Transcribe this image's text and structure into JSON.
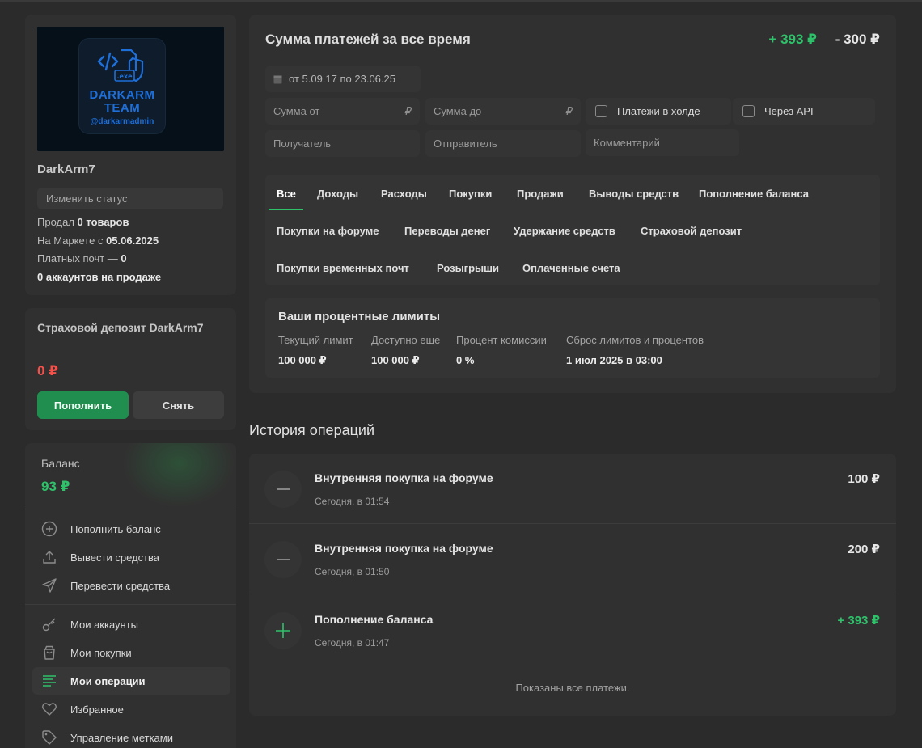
{
  "profile": {
    "logo_line1": "DARKARM",
    "logo_line2": "TEAM",
    "logo_handle": "@darkarmadmin",
    "logo_badge": ".exe",
    "username": "DarkArm7",
    "status_placeholder": "Изменить статус",
    "sold_prefix": "Продал ",
    "sold_count": "0 товаров",
    "market_prefix": "На Маркете с ",
    "market_since": "05.06.2025",
    "mail_prefix": "Платных почт — ",
    "mail_count": "0",
    "accounts_for_sale": "0 аккаунтов на продаже"
  },
  "deposit": {
    "title": "Страховой депозит DarkArm7",
    "amount": "0 ₽",
    "topup_label": "Пополнить",
    "withdraw_label": "Снять"
  },
  "balance": {
    "label": "Баланс",
    "value": "93 ₽",
    "menu": [
      {
        "label": "Пополнить баланс",
        "icon": "plus-circle-icon"
      },
      {
        "label": "Вывести средства",
        "icon": "upload-icon"
      },
      {
        "label": "Перевести средства",
        "icon": "send-icon"
      },
      {
        "label": "Мои аккаунты",
        "icon": "key-icon"
      },
      {
        "label": "Мои покупки",
        "icon": "bag-icon"
      },
      {
        "label": "Мои операции",
        "icon": "list-icon",
        "active": true
      },
      {
        "label": "Избранное",
        "icon": "heart-icon"
      },
      {
        "label": "Управление метками",
        "icon": "tag-icon"
      }
    ]
  },
  "summary": {
    "title": "Сумма платежей за все время",
    "plus": "+ 393 ₽",
    "minus": "- 300 ₽",
    "date_range": "от 5.09.17 по 23.06.25",
    "sum_from_placeholder": "Сумма от",
    "sum_to_placeholder": "Сумма до",
    "currency_symbol": "₽",
    "hold_label": "Платежи в холде",
    "api_label": "Через API",
    "recipient_placeholder": "Получатель",
    "sender_placeholder": "Отправитель",
    "comment_placeholder": "Комментарий",
    "tabs": [
      "Все",
      "Доходы",
      "Расходы",
      "Покупки",
      "Продажи",
      "Выводы средств",
      "Пополнение баланса",
      "Покупки на форуме",
      "Переводы денег",
      "Удержание средств",
      "Страховой депозит",
      "Покупки временных почт",
      "Розыгрыши",
      "Оплаченные счета"
    ]
  },
  "limits": {
    "title": "Ваши процентные лимиты",
    "columns": [
      {
        "head": "Текущий лимит",
        "value": "100 000 ₽"
      },
      {
        "head": "Доступно еще",
        "value": "100 000 ₽"
      },
      {
        "head": "Процент комиссии",
        "value": "0 %"
      },
      {
        "head": "Сброс лимитов и процентов",
        "value": "1 июл 2025 в 03:00"
      }
    ]
  },
  "history": {
    "title": "История операций",
    "operations": [
      {
        "name": "Внутренняя покупка на форуме",
        "time": "Сегодня, в 01:54",
        "amount": "100 ₽",
        "type": "minus"
      },
      {
        "name": "Внутренняя покупка на форуме",
        "time": "Сегодня, в 01:50",
        "amount": "200 ₽",
        "type": "minus"
      },
      {
        "name": "Пополнение баланса",
        "time": "Сегодня, в 01:47",
        "amount": "+ 393 ₽",
        "type": "plus"
      }
    ],
    "footer": "Показаны все платежи."
  },
  "colors": {
    "accent_green": "#2ec26a",
    "negative_red": "#f5504a",
    "background": "#2b2b2b",
    "card": "#303030"
  }
}
